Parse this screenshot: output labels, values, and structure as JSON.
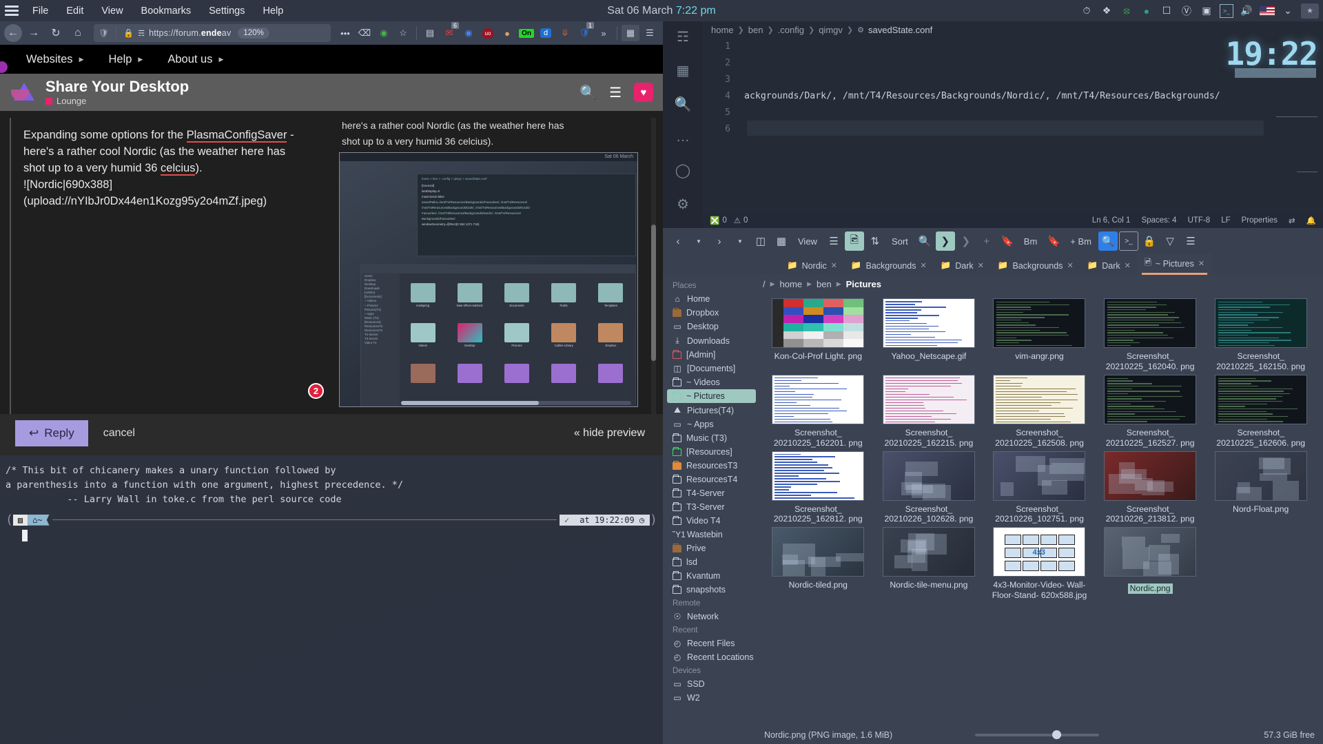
{
  "panel": {
    "menu": [
      "File",
      "Edit",
      "View",
      "Bookmarks",
      "Settings",
      "Help"
    ],
    "clock_date": "Sat 06 March ",
    "clock_time": "7:22 pm",
    "tray_icons": [
      "bell-icon",
      "dropbox-icon",
      "backup-icon",
      "krita-icon",
      "inbox-icon",
      "qbittorrent-icon",
      "screenshot-icon",
      "terminal-icon",
      "volume-icon",
      "us-flag-icon",
      "chevron-down-icon",
      "folder-star-icon"
    ]
  },
  "browser": {
    "nav": {
      "back": "←",
      "forward": "→",
      "reload": "↻",
      "home": "⌂",
      "url_prefix": "https://forum.",
      "url_bold": "ende",
      "url_rest": "av",
      "zoom": "120%",
      "shield_icon": "shield-icon",
      "lock_icon": "lock-icon",
      "perm_icon": "permissions-icon",
      "overflow": "•••",
      "pocket_icon": "pocket-icon",
      "globe_icon": "globe-icon",
      "star_icon": "☆"
    },
    "extensions": [
      {
        "name": "sidebar-icon",
        "glyph": "▤",
        "badge": ""
      },
      {
        "name": "mail-icon",
        "glyph": "✉",
        "badge": "6"
      },
      {
        "name": "chrome-icon",
        "glyph": "",
        "badge": ""
      },
      {
        "name": "ublock-icon",
        "glyph": "uo",
        "badge": ""
      },
      {
        "name": "avatar-icon",
        "glyph": "",
        "badge": ""
      },
      {
        "name": "noscript-on-icon",
        "glyph": "On",
        "badge": ""
      },
      {
        "name": "joplin-icon",
        "glyph": "d",
        "badge": ""
      },
      {
        "name": "vpn-icon",
        "glyph": "╱",
        "badge": ""
      },
      {
        "name": "shield-ext-icon",
        "glyph": "U",
        "badge": "1"
      },
      {
        "name": "more-extensions-icon",
        "glyph": "»",
        "badge": ""
      },
      {
        "name": "grid-icon",
        "glyph": "∷",
        "badge": ""
      },
      {
        "name": "hamburger-icon",
        "glyph": "☰",
        "badge": ""
      }
    ],
    "bookmarks": [
      "Websites",
      "Help",
      "About us"
    ],
    "forum": {
      "title": "Share Your Desktop",
      "category": "Lounge",
      "search_icon": "search-icon",
      "menu_icon": "hamburger-icon",
      "heart_icon": "heart-icon"
    },
    "composer": {
      "line1_a": "Expanding some options for the ",
      "line1_link": "PlasmaConfigSaver",
      "line1_b": " -",
      "line2": "here's a rather cool Nordic (as the weather here has",
      "line3_a": "shot up to a very humid 36 ",
      "line3_spell": "celcius",
      "line3_b": ").",
      "line4": "![Nordic|690x388]",
      "line5": "(upload://nYIbJr0Dx44en1Kozg95y2o4mZf.jpeg)",
      "error_count": "2",
      "preview_line1": "here's a rather cool Nordic (as the weather here has",
      "preview_line2": "shot up to a very humid 36 celcius).",
      "shot_caption": "Sat 06 March"
    },
    "actions": {
      "reply": "Reply",
      "reply_icon": "reply-arrow-icon",
      "cancel": "cancel",
      "hide_preview": "« hide preview"
    }
  },
  "terminal": {
    "lines": [
      "/* This bit of chicanery makes a unary function followed by",
      "a parenthesis into a function with one argument, highest precedence. */",
      "           -- Larry Wall in toke.c from the perl source code"
    ],
    "prompt_seg1": "▧",
    "prompt_seg2": "⌂~",
    "status_ok": "✓",
    "status_time": "at 19:22:09 ◷"
  },
  "editor": {
    "breadcrumb": [
      "home",
      "ben",
      ".config",
      "qimgv",
      "savedState.conf"
    ],
    "gear_icon": "gear-icon",
    "lines": [
      {
        "num": "1",
        "text": ""
      },
      {
        "num": "2",
        "text": ""
      },
      {
        "num": "3",
        "text": ""
      },
      {
        "num": "4",
        "text": "ackgrounds/Dark/, /mnt/T4/Resources/Backgrounds/Nordic/, /mnt/T4/Resources/Backgrounds/"
      },
      {
        "num": "5",
        "text": ""
      },
      {
        "num": "6",
        "text": ""
      }
    ],
    "activity_icons": [
      "explorer-icon",
      "extensions-icon",
      "search-icon",
      "more-icon",
      "account-icon",
      "settings-gear-icon"
    ],
    "clock_overlay": "19:22",
    "status": {
      "errors": "0",
      "warnings": "0",
      "position": "Ln 6, Col 1",
      "spaces": "Spaces: 4",
      "encoding": "UTF-8",
      "eol": "LF",
      "properties": "Properties",
      "remote_icon": "remote-icon",
      "bell_icon": "bell-icon"
    }
  },
  "dolphin": {
    "toolbar": {
      "back": "‹",
      "forward": "›",
      "split_icon": "split-view-icon",
      "icons_icon": "icons-view-icon",
      "view_label": "View",
      "details_icon": "details-view-icon",
      "preview_icon": "preview-icon",
      "sort_icon": "sort-icon",
      "sort_label": "Sort",
      "search_icon": "search-icon",
      "terminal_panel_icon": "terminal-panel-icon",
      "plus": "+",
      "bookmark_icon": "bookmark-icon",
      "bm_label": "Bm",
      "bookmark_add_icon": "bookmark-add-icon",
      "add_bm_label": "+ Bm",
      "find_icon": "find-files-icon",
      "konsole_icon": "konsole-icon",
      "lock_icon": "lock-icon",
      "filter_icon": "filter-icon",
      "menu_icon": "hamburger-icon"
    },
    "tabs": [
      {
        "label": "Nordic",
        "active": false
      },
      {
        "label": "Backgrounds",
        "active": false
      },
      {
        "label": "Dark",
        "active": false
      },
      {
        "label": "Backgrounds",
        "active": false
      },
      {
        "label": "Dark",
        "active": false
      },
      {
        "label": "~ Pictures",
        "active": true
      }
    ],
    "places": {
      "sections": [
        {
          "title": "Places",
          "items": [
            {
              "label": "Home",
              "icon": "home-icon",
              "kind": "glyph",
              "glyph": "⌂"
            },
            {
              "label": "Dropbox",
              "icon": "dropbox-folder-icon",
              "kind": "brown"
            },
            {
              "label": "Desktop",
              "icon": "desktop-icon",
              "kind": "glyph",
              "glyph": "▭"
            },
            {
              "label": "Downloads",
              "icon": "download-icon",
              "kind": "glyph",
              "glyph": "⤓"
            },
            {
              "label": "[Admin]",
              "icon": "folder-icon",
              "kind": "red"
            },
            {
              "label": "[Documents]",
              "icon": "documents-icon",
              "kind": "glyph",
              "glyph": "◫"
            },
            {
              "label": "~ Videos",
              "icon": "folder-icon",
              "kind": "plain"
            },
            {
              "label": "~ Pictures",
              "icon": "folder-icon",
              "kind": "teal",
              "selected": true
            },
            {
              "label": "Pictures(T4)",
              "icon": "pictures-icon",
              "kind": "glyph",
              "glyph": "⛰"
            },
            {
              "label": "~ Apps",
              "icon": "apps-icon",
              "kind": "glyph",
              "glyph": "▭"
            },
            {
              "label": "Music (T3)",
              "icon": "folder-icon",
              "kind": "plain"
            },
            {
              "label": "[Resources]",
              "icon": "folder-icon",
              "kind": "green"
            },
            {
              "label": "ResourcesT3",
              "icon": "folder-icon",
              "kind": "orange"
            },
            {
              "label": "ResourcesT4",
              "icon": "folder-icon",
              "kind": "plain"
            },
            {
              "label": "T4-Server",
              "icon": "folder-icon",
              "kind": "plain"
            },
            {
              "label": "T3-Server",
              "icon": "folder-icon",
              "kind": "plain"
            },
            {
              "label": "Video T4",
              "icon": "folder-icon",
              "kind": "plain"
            },
            {
              "label": "Wastebin",
              "icon": "trash-icon",
              "kind": "glyph",
              "glyph": "Ὕ1"
            },
            {
              "label": "Prive",
              "icon": "folder-icon",
              "kind": "brown"
            },
            {
              "label": "lsd",
              "icon": "folder-icon",
              "kind": "plain"
            },
            {
              "label": "Kvantum",
              "icon": "folder-icon",
              "kind": "plain"
            },
            {
              "label": "snapshots",
              "icon": "folder-icon",
              "kind": "plain"
            }
          ]
        },
        {
          "title": "Remote",
          "items": [
            {
              "label": "Network",
              "icon": "network-icon",
              "kind": "glyph",
              "glyph": "☉"
            }
          ]
        },
        {
          "title": "Recent",
          "items": [
            {
              "label": "Recent Files",
              "icon": "recent-files-icon",
              "kind": "glyph",
              "glyph": "◴"
            },
            {
              "label": "Recent Locations",
              "icon": "recent-locations-icon",
              "kind": "glyph",
              "glyph": "◴"
            }
          ]
        },
        {
          "title": "Devices",
          "items": [
            {
              "label": "SSD",
              "icon": "drive-icon",
              "kind": "glyph",
              "glyph": "▭"
            },
            {
              "label": "W2",
              "icon": "drive-icon",
              "kind": "glyph",
              "glyph": "▭"
            }
          ]
        }
      ]
    },
    "path": [
      "/",
      "home",
      "ben",
      "Pictures"
    ],
    "files": [
      {
        "name": "Kon-Col-Prof Light.\npng",
        "thumb": "konsole-colors",
        "selected": false
      },
      {
        "name": "Yahoo_Netscape.gif",
        "thumb": "webpage",
        "selected": false
      },
      {
        "name": "vim-angr.png",
        "thumb": "terminal",
        "selected": false
      },
      {
        "name": "Screenshot_\n20210225_162040.\npng",
        "thumb": "terminal",
        "selected": false
      },
      {
        "name": "Screenshot_\n20210225_162150.\npng",
        "thumb": "terminal-teal",
        "selected": false
      },
      {
        "name": "Screenshot_\n20210225_162201.\npng",
        "thumb": "webpage",
        "selected": false
      },
      {
        "name": "Screenshot_\n20210225_162215.\npng",
        "thumb": "webpage-pink",
        "selected": false
      },
      {
        "name": "Screenshot_\n20210225_162508.\npng",
        "thumb": "webpage-cream",
        "selected": false
      },
      {
        "name": "Screenshot_\n20210225_162527.\npng",
        "thumb": "terminal",
        "selected": false
      },
      {
        "name": "Screenshot_\n20210225_162606.\npng",
        "thumb": "terminal",
        "selected": false
      },
      {
        "name": "Screenshot_\n20210225_162812.\npng",
        "thumb": "webpage",
        "selected": false
      },
      {
        "name": "Screenshot_\n20210226_102628.\npng",
        "thumb": "desktop-dark",
        "selected": false
      },
      {
        "name": "Screenshot_\n20210226_102751.\npng",
        "thumb": "desktop-dark",
        "selected": false
      },
      {
        "name": "Screenshot_\n20210226_213812.\npng",
        "thumb": "desktop-red",
        "selected": false
      },
      {
        "name": "Nord-Float.png",
        "thumb": "desktop-nord",
        "selected": false
      },
      {
        "name": "Nordic-tiled.png",
        "thumb": "desktop-tiled",
        "selected": false
      },
      {
        "name": "Nordic-tile-menu.png",
        "thumb": "desktop-menu",
        "selected": false
      },
      {
        "name": "4x3-Monitor-Video-\nWall-Floor-Stand-\n620x588.jpg",
        "thumb": "monitor-wall",
        "selected": false
      },
      {
        "name": "Nordic.png",
        "thumb": "desktop-grid",
        "selected": true
      }
    ],
    "status": {
      "selection": "Nordic.png (PNG image, 1.6 MiB)",
      "free_space": "57.3 GiB free"
    }
  }
}
